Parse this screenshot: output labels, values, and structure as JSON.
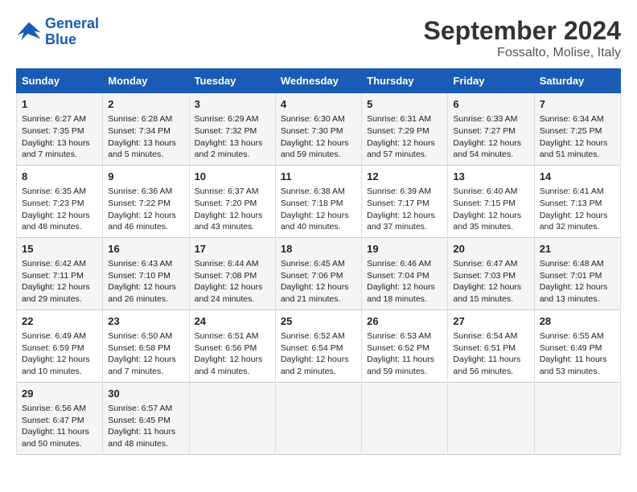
{
  "header": {
    "logo_line1": "General",
    "logo_line2": "Blue",
    "month": "September 2024",
    "location": "Fossalto, Molise, Italy"
  },
  "columns": [
    "Sunday",
    "Monday",
    "Tuesday",
    "Wednesday",
    "Thursday",
    "Friday",
    "Saturday"
  ],
  "weeks": [
    [
      {
        "day": "1",
        "lines": "Sunrise: 6:27 AM\nSunset: 7:35 PM\nDaylight: 13 hours\nand 7 minutes."
      },
      {
        "day": "2",
        "lines": "Sunrise: 6:28 AM\nSunset: 7:34 PM\nDaylight: 13 hours\nand 5 minutes."
      },
      {
        "day": "3",
        "lines": "Sunrise: 6:29 AM\nSunset: 7:32 PM\nDaylight: 13 hours\nand 2 minutes."
      },
      {
        "day": "4",
        "lines": "Sunrise: 6:30 AM\nSunset: 7:30 PM\nDaylight: 12 hours\nand 59 minutes."
      },
      {
        "day": "5",
        "lines": "Sunrise: 6:31 AM\nSunset: 7:29 PM\nDaylight: 12 hours\nand 57 minutes."
      },
      {
        "day": "6",
        "lines": "Sunrise: 6:33 AM\nSunset: 7:27 PM\nDaylight: 12 hours\nand 54 minutes."
      },
      {
        "day": "7",
        "lines": "Sunrise: 6:34 AM\nSunset: 7:25 PM\nDaylight: 12 hours\nand 51 minutes."
      }
    ],
    [
      {
        "day": "8",
        "lines": "Sunrise: 6:35 AM\nSunset: 7:23 PM\nDaylight: 12 hours\nand 48 minutes."
      },
      {
        "day": "9",
        "lines": "Sunrise: 6:36 AM\nSunset: 7:22 PM\nDaylight: 12 hours\nand 46 minutes."
      },
      {
        "day": "10",
        "lines": "Sunrise: 6:37 AM\nSunset: 7:20 PM\nDaylight: 12 hours\nand 43 minutes."
      },
      {
        "day": "11",
        "lines": "Sunrise: 6:38 AM\nSunset: 7:18 PM\nDaylight: 12 hours\nand 40 minutes."
      },
      {
        "day": "12",
        "lines": "Sunrise: 6:39 AM\nSunset: 7:17 PM\nDaylight: 12 hours\nand 37 minutes."
      },
      {
        "day": "13",
        "lines": "Sunrise: 6:40 AM\nSunset: 7:15 PM\nDaylight: 12 hours\nand 35 minutes."
      },
      {
        "day": "14",
        "lines": "Sunrise: 6:41 AM\nSunset: 7:13 PM\nDaylight: 12 hours\nand 32 minutes."
      }
    ],
    [
      {
        "day": "15",
        "lines": "Sunrise: 6:42 AM\nSunset: 7:11 PM\nDaylight: 12 hours\nand 29 minutes."
      },
      {
        "day": "16",
        "lines": "Sunrise: 6:43 AM\nSunset: 7:10 PM\nDaylight: 12 hours\nand 26 minutes."
      },
      {
        "day": "17",
        "lines": "Sunrise: 6:44 AM\nSunset: 7:08 PM\nDaylight: 12 hours\nand 24 minutes."
      },
      {
        "day": "18",
        "lines": "Sunrise: 6:45 AM\nSunset: 7:06 PM\nDaylight: 12 hours\nand 21 minutes."
      },
      {
        "day": "19",
        "lines": "Sunrise: 6:46 AM\nSunset: 7:04 PM\nDaylight: 12 hours\nand 18 minutes."
      },
      {
        "day": "20",
        "lines": "Sunrise: 6:47 AM\nSunset: 7:03 PM\nDaylight: 12 hours\nand 15 minutes."
      },
      {
        "day": "21",
        "lines": "Sunrise: 6:48 AM\nSunset: 7:01 PM\nDaylight: 12 hours\nand 13 minutes."
      }
    ],
    [
      {
        "day": "22",
        "lines": "Sunrise: 6:49 AM\nSunset: 6:59 PM\nDaylight: 12 hours\nand 10 minutes."
      },
      {
        "day": "23",
        "lines": "Sunrise: 6:50 AM\nSunset: 6:58 PM\nDaylight: 12 hours\nand 7 minutes."
      },
      {
        "day": "24",
        "lines": "Sunrise: 6:51 AM\nSunset: 6:56 PM\nDaylight: 12 hours\nand 4 minutes."
      },
      {
        "day": "25",
        "lines": "Sunrise: 6:52 AM\nSunset: 6:54 PM\nDaylight: 12 hours\nand 2 minutes."
      },
      {
        "day": "26",
        "lines": "Sunrise: 6:53 AM\nSunset: 6:52 PM\nDaylight: 11 hours\nand 59 minutes."
      },
      {
        "day": "27",
        "lines": "Sunrise: 6:54 AM\nSunset: 6:51 PM\nDaylight: 11 hours\nand 56 minutes."
      },
      {
        "day": "28",
        "lines": "Sunrise: 6:55 AM\nSunset: 6:49 PM\nDaylight: 11 hours\nand 53 minutes."
      }
    ],
    [
      {
        "day": "29",
        "lines": "Sunrise: 6:56 AM\nSunset: 6:47 PM\nDaylight: 11 hours\nand 50 minutes."
      },
      {
        "day": "30",
        "lines": "Sunrise: 6:57 AM\nSunset: 6:45 PM\nDaylight: 11 hours\nand 48 minutes."
      },
      {
        "day": "",
        "lines": ""
      },
      {
        "day": "",
        "lines": ""
      },
      {
        "day": "",
        "lines": ""
      },
      {
        "day": "",
        "lines": ""
      },
      {
        "day": "",
        "lines": ""
      }
    ]
  ]
}
